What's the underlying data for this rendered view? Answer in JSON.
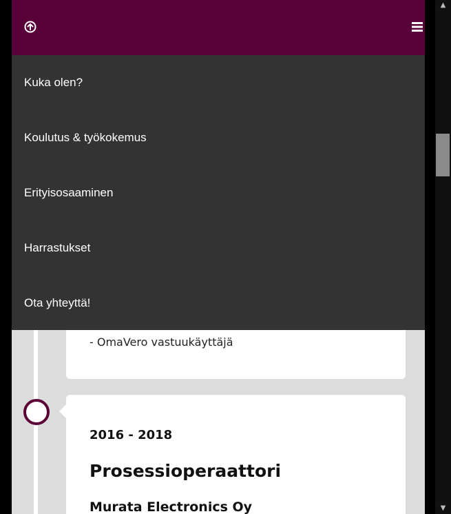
{
  "header": {
    "up_icon": "arrow-up-circle-icon",
    "menu_icon": "hamburger-menu-icon"
  },
  "nav": {
    "items": [
      {
        "label": "Kuka olen?"
      },
      {
        "label": "Koulutus & työkokemus"
      },
      {
        "label": "Erityisosaaminen"
      },
      {
        "label": "Harrastukset"
      },
      {
        "label": "Ota yhteyttä!"
      }
    ]
  },
  "timeline": {
    "prev_entry": {
      "text": "- OmaVero vastuukäyttäjä"
    },
    "entry": {
      "dates": "2016 - 2018",
      "title": "Prosessioperaattori",
      "company": "Murata Electronics Oy"
    }
  },
  "colors": {
    "brand": "#58003a",
    "menu_bg": "#333333",
    "page_bg": "#dcdcdc"
  }
}
